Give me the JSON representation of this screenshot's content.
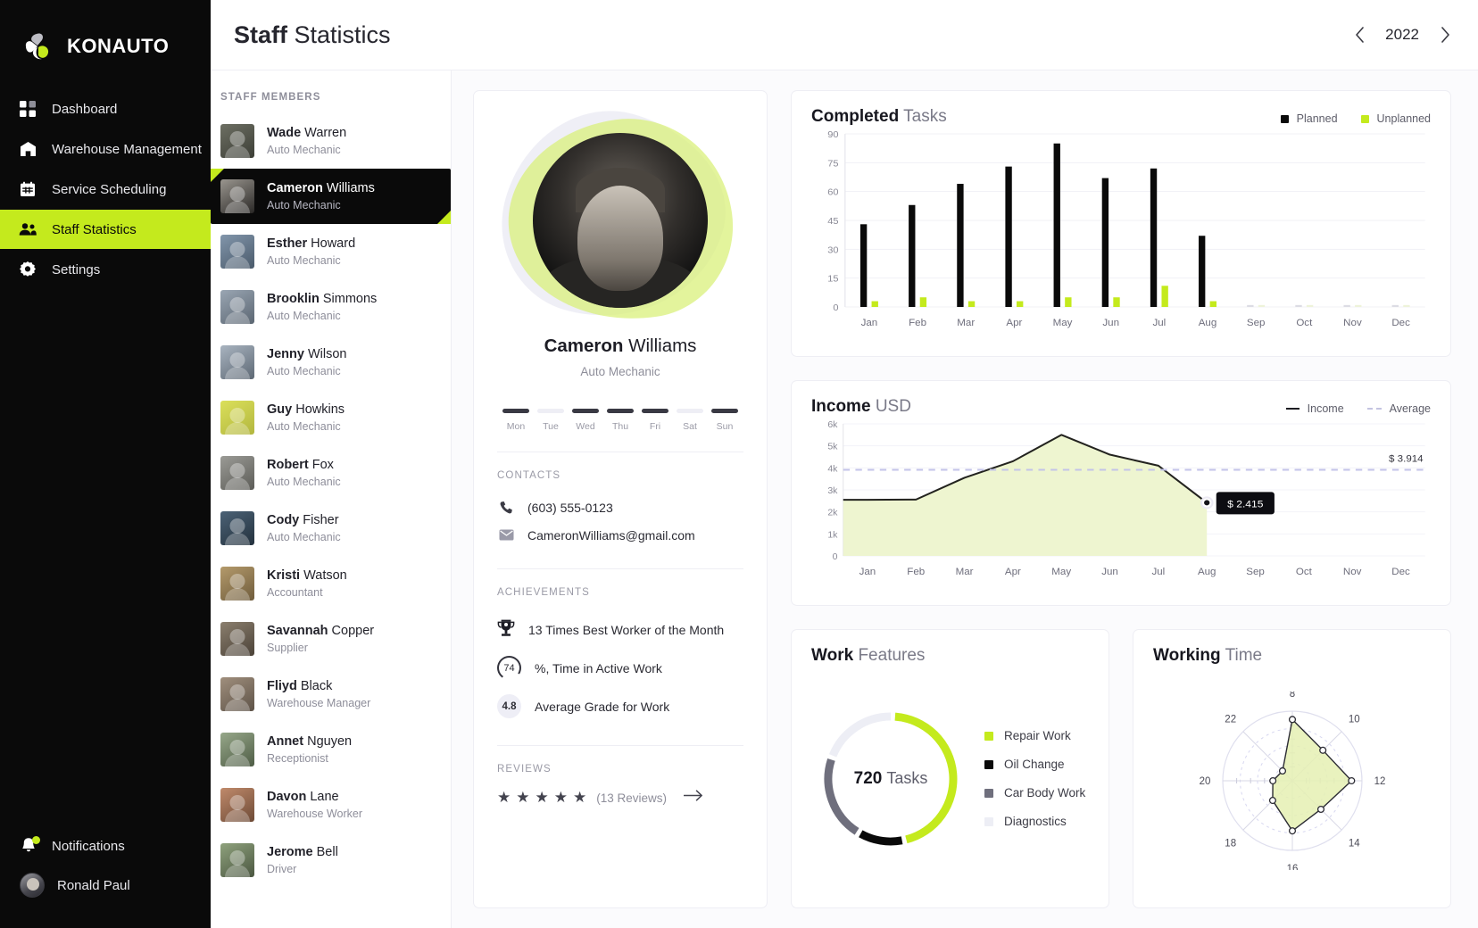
{
  "brand": {
    "name": "KONAUTO",
    "logo_icon": "clover-logo-icon"
  },
  "sidebar": {
    "items": [
      {
        "label": "Dashboard",
        "icon": "grid-icon",
        "active": false
      },
      {
        "label": "Warehouse Management",
        "icon": "warehouse-icon",
        "active": false
      },
      {
        "label": "Service Scheduling",
        "icon": "calendar-icon",
        "active": false
      },
      {
        "label": "Staff Statistics",
        "icon": "people-icon",
        "active": true
      },
      {
        "label": "Settings",
        "icon": "gear-icon",
        "active": false
      }
    ],
    "bottom": [
      {
        "label": "Notifications",
        "icon": "bell-icon"
      },
      {
        "label": "Ronald Paul",
        "icon": "avatar"
      }
    ]
  },
  "header": {
    "title_bold": "Staff",
    "title_rest": "Statistics",
    "year": "2022",
    "prev_icon": "chevron-left-icon",
    "next_icon": "chevron-right-icon"
  },
  "staff_panel": {
    "heading": "STAFF MEMBERS",
    "members": [
      {
        "first": "Wade",
        "last": "Warren",
        "role": "Auto Mechanic",
        "selected": false,
        "c1": "#6d6f63",
        "c2": "#3c3e36"
      },
      {
        "first": "Cameron",
        "last": "Williams",
        "role": "Auto Mechanic",
        "selected": true,
        "c1": "#9a968f",
        "c2": "#2a2826"
      },
      {
        "first": "Esther",
        "last": "Howard",
        "role": "Auto Mechanic",
        "selected": false,
        "c1": "#8296ab",
        "c2": "#4a5a6b"
      },
      {
        "first": "Brooklin",
        "last": "Simmons",
        "role": "Auto Mechanic",
        "selected": false,
        "c1": "#9aa6b3",
        "c2": "#5b6672"
      },
      {
        "first": "Jenny",
        "last": "Wilson",
        "role": "Auto Mechanic",
        "selected": false,
        "c1": "#a9b4c0",
        "c2": "#5d6874"
      },
      {
        "first": "Guy",
        "last": "Howkins",
        "role": "Auto Mechanic",
        "selected": false,
        "c1": "#dbe05a",
        "c2": "#b2b63f"
      },
      {
        "first": "Robert",
        "last": "Fox",
        "role": "Auto Mechanic",
        "selected": false,
        "c1": "#9b9b96",
        "c2": "#5c5c57"
      },
      {
        "first": "Cody",
        "last": "Fisher",
        "role": "Auto Mechanic",
        "selected": false,
        "c1": "#4c6276",
        "c2": "#23313d"
      },
      {
        "first": "Kristi",
        "last": "Watson",
        "role": "Accountant",
        "selected": false,
        "c1": "#b49a6b",
        "c2": "#6f5c3c"
      },
      {
        "first": "Savannah",
        "last": "Copper",
        "role": "Supplier",
        "selected": false,
        "c1": "#8b7f6e",
        "c2": "#4b4238"
      },
      {
        "first": "Fliyd",
        "last": "Black",
        "role": "Warehouse Manager",
        "selected": false,
        "c1": "#a08f7d",
        "c2": "#5d5247"
      },
      {
        "first": "Annet",
        "last": "Nguyen",
        "role": "Receptionist",
        "selected": false,
        "c1": "#97a88a",
        "c2": "#4e5c45"
      },
      {
        "first": "Davon",
        "last": "Lane",
        "role": "Warehouse Worker",
        "selected": false,
        "c1": "#c08a6b",
        "c2": "#6d4a36"
      },
      {
        "first": "Jerome",
        "last": "Bell",
        "role": "Driver",
        "selected": false,
        "c1": "#8fa27d",
        "c2": "#4a5640"
      }
    ]
  },
  "profile": {
    "first_name": "Cameron",
    "last_name": "Williams",
    "role": "Auto Mechanic",
    "week": [
      {
        "day": "Mon",
        "on": true
      },
      {
        "day": "Tue",
        "on": false
      },
      {
        "day": "Wed",
        "on": true
      },
      {
        "day": "Thu",
        "on": true
      },
      {
        "day": "Fri",
        "on": true
      },
      {
        "day": "Sat",
        "on": false
      },
      {
        "day": "Sun",
        "on": true
      }
    ],
    "contacts_heading": "CONTACTS",
    "phone": "(603) 555-0123",
    "email": "CameronWilliams@gmail.com",
    "phone_icon": "phone-icon",
    "email_icon": "envelope-icon",
    "achievements_heading": "ACHIEVEMENTS",
    "achievements": [
      {
        "badge": "trophy-icon",
        "value": "",
        "text": "13 Times Best Worker of the Month"
      },
      {
        "badge": "progress-ring",
        "value": "74",
        "text": "%, Time in Active Work"
      },
      {
        "badge": "grade-pill",
        "value": "4.8",
        "text": "Average Grade for Work"
      }
    ],
    "reviews_heading": "REVIEWS",
    "stars": 5,
    "reviews_count": "(13 Reviews)",
    "reviews_arrow_icon": "arrow-right-icon"
  },
  "colors": {
    "accent": "#c4ea1d",
    "dark": "#0a0a0a",
    "gray": "#6b6b78",
    "pale": "#ededf3",
    "area_fill": "#eef5d0"
  },
  "chart_data": [
    {
      "type": "bar",
      "title_bold": "Completed",
      "title_rest": "Tasks",
      "categories": [
        "Jan",
        "Feb",
        "Mar",
        "Apr",
        "May",
        "Jun",
        "Jul",
        "Aug",
        "Sep",
        "Oct",
        "Nov",
        "Dec"
      ],
      "series": [
        {
          "name": "Planned",
          "color": "#0a0a0a",
          "values": [
            43,
            53,
            64,
            73,
            85,
            67,
            72,
            37,
            1,
            1,
            1,
            1
          ]
        },
        {
          "name": "Unplanned",
          "color": "#c4ea1d",
          "values": [
            3,
            5,
            3,
            3,
            5,
            5,
            11,
            3,
            1,
            1,
            1,
            1
          ]
        }
      ],
      "ylim": [
        0,
        90
      ],
      "yticks": [
        0,
        15,
        30,
        45,
        60,
        75,
        90
      ],
      "xlabel": "",
      "ylabel": "",
      "grid": true,
      "legend_position": "top-right"
    },
    {
      "type": "area",
      "title_bold": "Income",
      "title_rest": "USD",
      "categories": [
        "Jan",
        "Feb",
        "Mar",
        "Apr",
        "May",
        "Jun",
        "Jul",
        "Aug",
        "Sep",
        "Oct",
        "Nov",
        "Dec"
      ],
      "series": [
        {
          "name": "Income",
          "color": "#1c1c22",
          "values": [
            2550,
            2560,
            3550,
            4300,
            5500,
            4600,
            4100,
            2415,
            null,
            null,
            null,
            null
          ]
        },
        {
          "name": "Average",
          "color": "#c3c3e0",
          "style": "dashed",
          "value": 3914
        }
      ],
      "average_label": "$ 3.914",
      "tooltip": {
        "label": "$ 2.415",
        "at_category": "Aug"
      },
      "ylim": [
        0,
        6000
      ],
      "yticks": [
        "0",
        "1k",
        "2k",
        "3k",
        "4k",
        "5k",
        "6k"
      ],
      "grid": true,
      "legend_position": "top-right"
    },
    {
      "type": "pie",
      "title_bold": "Work",
      "title_rest": "Features",
      "center_value": "720",
      "center_label": "Tasks",
      "labels": [
        "Repair Work",
        "Oil Change",
        "Car Body Work",
        "Diagnostics"
      ],
      "colors": [
        "#c4ea1d",
        "#0a0a0a",
        "#6f6f7d",
        "#edeef5"
      ],
      "values": [
        46,
        12,
        22,
        20
      ]
    },
    {
      "type": "radar",
      "title_bold": "Working",
      "title_rest": "Time",
      "axis_labels": [
        "8",
        "10",
        "12",
        "14",
        "16",
        "18",
        "20",
        "22"
      ],
      "values": [
        0.88,
        0.62,
        0.85,
        0.58,
        0.72,
        0.4,
        0.28,
        0.2
      ],
      "grid": true
    }
  ]
}
